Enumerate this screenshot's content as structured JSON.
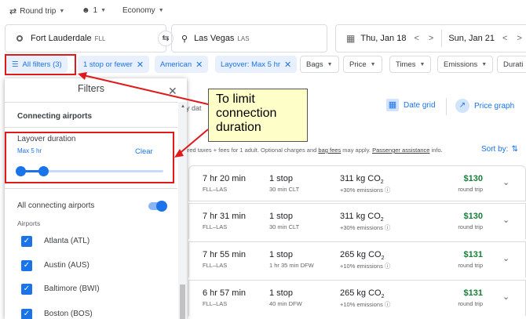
{
  "search": {
    "trip_type": "Round trip",
    "passengers": "1",
    "cabin": "Economy",
    "origin": "Fort Lauderdale",
    "origin_code": "FLL",
    "destination": "Las Vegas",
    "destination_code": "LAS",
    "depart_date": "Thu, Jan 18",
    "return_date": "Sun, Jan 21"
  },
  "chips": {
    "all_filters": "All filters (3)",
    "stops": "1 stop or fewer",
    "airline": "American",
    "layover": "Layover: Max 5 hr",
    "bags": "Bags",
    "price": "Price",
    "times": "Times",
    "emissions": "Emissions",
    "duration": "Durati"
  },
  "panel": {
    "title": "Filters",
    "section": "Connecting airports",
    "layover_label": "Layover duration",
    "layover_value": "Max 5 hr",
    "clear": "Clear",
    "slider_fraction": 0.18,
    "all_connecting": "All connecting airports",
    "airports_heading": "Airports",
    "airports": [
      "Atlanta (ATL)",
      "Austin (AUS)",
      "Baltimore (BWI)",
      "Boston (BOS)"
    ]
  },
  "callout": {
    "line1": "To limit",
    "line2": "connection",
    "line3": "duration"
  },
  "main": {
    "any_dates": "ny dat",
    "date_grid": "Date grid",
    "price_graph": "Price graph",
    "notice_prefix": "uired taxes + fees for 1 adult. Optional charges and ",
    "bag_fees": "bag fees",
    "notice_mid": " may apply. ",
    "assistance": "Passenger assistance",
    "notice_end": " info.",
    "sort_by": "Sort by:"
  },
  "flights": [
    {
      "duration": "7 hr 20 min",
      "route": "FLL–LAS",
      "stops": "1 stop",
      "stop_detail": "30 min CLT",
      "co2": "311 kg CO",
      "emissions": "+30% emissions",
      "price": "$130",
      "price_note": "round trip"
    },
    {
      "duration": "7 hr 31 min",
      "route": "FLL–LAS",
      "stops": "1 stop",
      "stop_detail": "30 min CLT",
      "co2": "311 kg CO",
      "emissions": "+30% emissions",
      "price": "$130",
      "price_note": "round trip"
    },
    {
      "duration": "7 hr 55 min",
      "route": "FLL–LAS",
      "stops": "1 stop",
      "stop_detail": "1 hr 35 min DFW",
      "co2": "265 kg CO",
      "emissions": "+10% emissions",
      "price": "$131",
      "price_note": "round trip"
    },
    {
      "duration": "6 hr 57 min",
      "route": "FLL–LAS",
      "stops": "1 stop",
      "stop_detail": "40 min DFW",
      "co2": "265 kg CO",
      "emissions": "+10% emissions",
      "price": "$131",
      "price_note": "round trip"
    }
  ],
  "colors": {
    "accent": "#1a73e8",
    "annotation": "#e01a1a",
    "price": "#188038",
    "callout_bg": "#fefec8"
  }
}
